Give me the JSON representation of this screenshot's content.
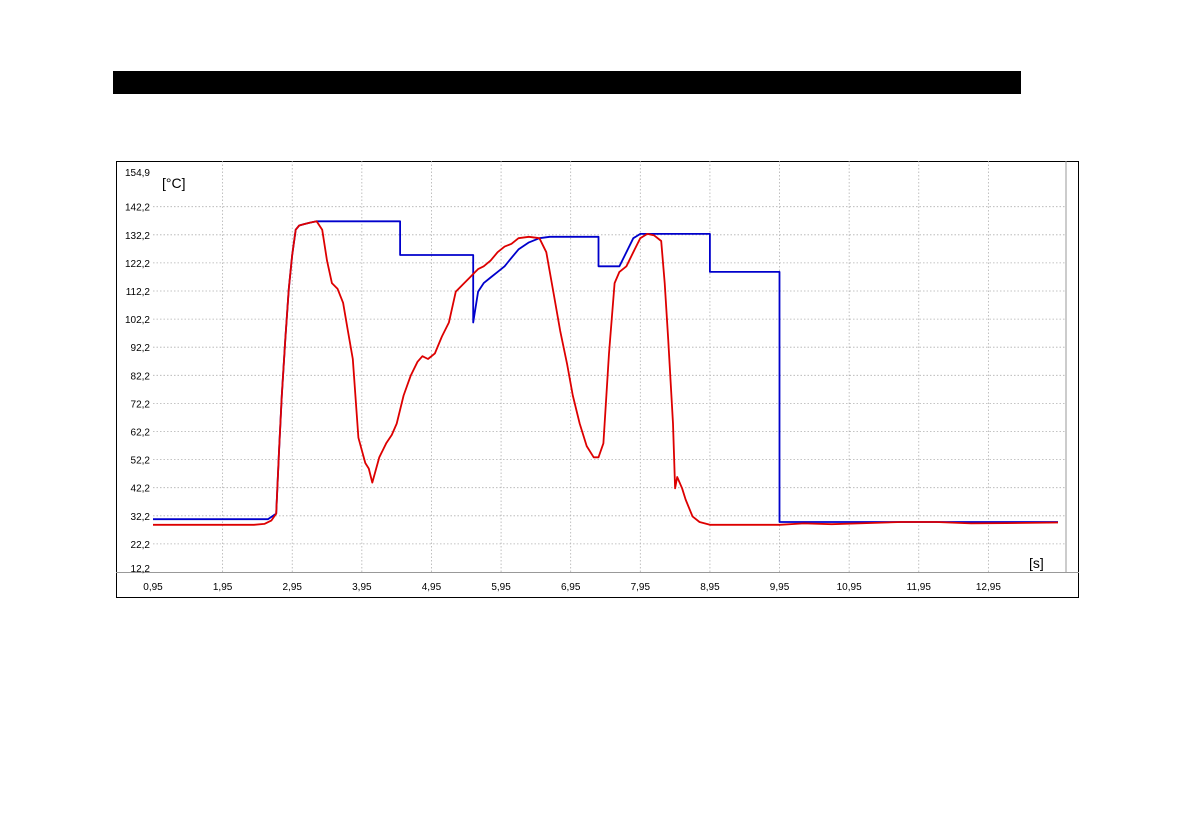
{
  "title_bar": {
    "text": "",
    "color": "#000000"
  },
  "chart_data": {
    "type": "line",
    "title": "",
    "xlabel": "[s]",
    "ylabel": "[°C]",
    "xlim": [
      0.95,
      13.95
    ],
    "ylim": [
      12.2,
      154.9
    ],
    "grid": true,
    "legend": "none",
    "x_ticks": [
      0.95,
      1.95,
      2.95,
      3.95,
      4.95,
      5.95,
      6.95,
      7.95,
      8.95,
      9.95,
      10.95,
      11.95,
      12.95
    ],
    "x_tick_labels": [
      "0,95",
      "1,95",
      "2,95",
      "3,95",
      "4,95",
      "5,95",
      "6,95",
      "7,95",
      "8,95",
      "9,95",
      "10,95",
      "11,95",
      "12,95"
    ],
    "y_ticks": [
      154.9,
      142.2,
      132.2,
      122.2,
      112.2,
      102.2,
      92.2,
      82.2,
      72.2,
      62.2,
      52.2,
      42.2,
      32.2,
      22.2,
      12.2
    ],
    "y_tick_labels": [
      "154,9",
      "142,2",
      "132,2",
      "122,2",
      "112,2",
      "102,2",
      "92,2",
      "82,2",
      "72,2",
      "62,2",
      "52,2",
      "42,2",
      "32,2",
      "22,2",
      "12,2"
    ],
    "series": [
      {
        "color": "#0000cc",
        "x": [
          0.95,
          2.6,
          2.72,
          2.76,
          2.8,
          2.85,
          2.9,
          2.95,
          3.0,
          3.05,
          3.12,
          3.2,
          3.3,
          4.5,
          4.5,
          5.55,
          5.55,
          5.62,
          5.7,
          5.8,
          5.9,
          6.0,
          6.1,
          6.2,
          6.35,
          6.5,
          6.65,
          7.35,
          7.35,
          7.65,
          7.75,
          7.85,
          7.95,
          8.05,
          8.95,
          8.95,
          9.95,
          9.95,
          13.95
        ],
        "y": [
          31.0,
          31.0,
          33.0,
          55.0,
          75.0,
          95.0,
          113.0,
          125.0,
          134.0,
          135.5,
          136.0,
          136.5,
          137.0,
          137.0,
          125.0,
          125.0,
          101.0,
          112.0,
          115.0,
          117.0,
          119.0,
          121.0,
          124.0,
          127.0,
          129.5,
          131.0,
          131.5,
          131.5,
          121.0,
          121.0,
          126.0,
          131.0,
          132.5,
          132.5,
          132.5,
          119.0,
          119.0,
          30.0,
          30.0
        ]
      },
      {
        "color": "#dd0000",
        "x": [
          0.95,
          2.4,
          2.55,
          2.65,
          2.72,
          2.76,
          2.8,
          2.85,
          2.9,
          2.95,
          3.0,
          3.05,
          3.12,
          3.2,
          3.3,
          3.38,
          3.45,
          3.52,
          3.6,
          3.68,
          3.75,
          3.82,
          3.9,
          4.0,
          4.05,
          4.1,
          4.2,
          4.3,
          4.38,
          4.45,
          4.55,
          4.65,
          4.75,
          4.82,
          4.9,
          5.0,
          5.1,
          5.2,
          5.3,
          5.42,
          5.5,
          5.58,
          5.62,
          5.7,
          5.8,
          5.9,
          6.0,
          6.1,
          6.2,
          6.35,
          6.5,
          6.6,
          6.7,
          6.8,
          6.9,
          6.98,
          7.08,
          7.18,
          7.28,
          7.35,
          7.42,
          7.5,
          7.58,
          7.65,
          7.75,
          7.85,
          7.95,
          8.05,
          8.15,
          8.25,
          8.3,
          8.35,
          8.42,
          8.45,
          8.48,
          8.55,
          8.6,
          8.7,
          8.8,
          8.95,
          9.2,
          9.6,
          9.95,
          10.3,
          10.7,
          11.2,
          11.7,
          12.2,
          12.7,
          13.2,
          13.95
        ],
        "y": [
          29.0,
          29.0,
          29.3,
          30.5,
          33.0,
          55.0,
          75.0,
          95.0,
          113.0,
          125.0,
          134.0,
          135.5,
          136.0,
          136.5,
          137.0,
          134.0,
          123.0,
          115.0,
          113.0,
          108.0,
          98.0,
          88.0,
          60.0,
          51.0,
          49.0,
          44.0,
          53.0,
          58.0,
          61.0,
          65.0,
          75.0,
          82.0,
          87.0,
          89.0,
          88.0,
          90.0,
          96.0,
          101.0,
          112.0,
          115.0,
          117.0,
          119.0,
          120.0,
          121.0,
          123.0,
          126.0,
          128.0,
          129.0,
          131.0,
          131.5,
          131.0,
          126.0,
          112.0,
          98.0,
          86.0,
          75.0,
          65.0,
          57.0,
          53.0,
          53.0,
          58.0,
          90.0,
          115.0,
          119.0,
          121.0,
          126.0,
          131.0,
          132.5,
          132.0,
          130.0,
          115.0,
          95.0,
          65.0,
          42.0,
          46.0,
          42.0,
          38.0,
          32.0,
          30.0,
          29.0,
          29.0,
          29.0,
          29.0,
          29.5,
          29.2,
          29.6,
          30.0,
          30.0,
          29.5,
          29.6,
          29.8
        ]
      }
    ]
  }
}
